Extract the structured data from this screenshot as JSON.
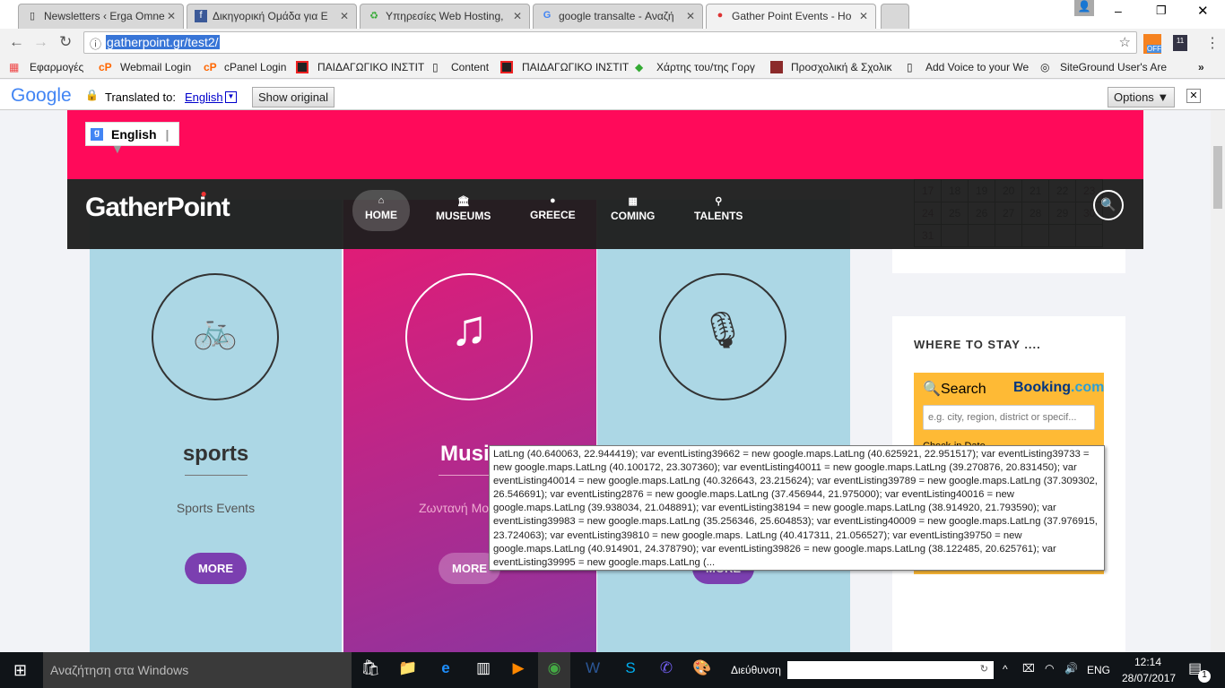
{
  "browser": {
    "tabs": [
      {
        "title": "Newsletters ‹ Erga Omne",
        "icon": "page-icon"
      },
      {
        "title": "Δικηγορική Ομάδα για Ε",
        "icon": "facebook-icon"
      },
      {
        "title": "Υπηρεσίες Web Hosting,",
        "icon": "recycle-icon"
      },
      {
        "title": "google transalte - Αναζή",
        "icon": "google-icon"
      },
      {
        "title": "Gather Point Events - Ho",
        "icon": "map-pin-icon"
      }
    ],
    "url": "gatherpoint.gr/test2/",
    "ext_badge": "OFF",
    "ext2": "11",
    "bookmarks": [
      "Εφαρμογές",
      "Webmail Login",
      "cPanel Login",
      "ΠΑΙΔΑΓΩΓΙΚΟ ΙΝΣΤΙΤ",
      "Content",
      "ΠΑΙΔΑΓΩΓΙΚΟ ΙΝΣΤΙΤ",
      "Χάρτης του/της Γοργ",
      "Προσχολική & Σχολικ",
      "Add Voice to your We",
      "SiteGround User's Are"
    ],
    "more_bookmarks": "»"
  },
  "translate": {
    "logo": "Google",
    "label": "Translated to:",
    "language": "English",
    "show_original": "Show original",
    "options": "Options ▼",
    "close": "✕"
  },
  "site": {
    "language_selector": "English",
    "logo": "GatherPoint",
    "nav": [
      {
        "label": "HOME",
        "icon": "⌂"
      },
      {
        "label": "MUSEUMS",
        "icon": "🏛"
      },
      {
        "label": "GREECE",
        "icon": "●"
      },
      {
        "label": "COMING",
        "icon": "▦"
      },
      {
        "label": "TALENTS",
        "icon": "⚲"
      }
    ],
    "cards": [
      {
        "title": "sports",
        "subtitle": "Sports Events",
        "button": "MORE",
        "icon": "🚲"
      },
      {
        "title": "Musi",
        "subtitle": "Ζωντανή Μο",
        "button": "MORE",
        "icon": "♫"
      },
      {
        "title": "",
        "subtitle": "",
        "button": "MORE",
        "icon": "🎙"
      }
    ],
    "calendar": [
      [
        "17",
        "18",
        "19",
        "20",
        "21",
        "22",
        "23"
      ],
      [
        "24",
        "25",
        "26",
        "27",
        "28",
        "29",
        "30"
      ],
      [
        "31",
        "",
        "",
        "",
        "",
        "",
        ""
      ]
    ],
    "where_to_stay": "WHERE TO STAY ....",
    "booking": {
      "search": "Search",
      "brand": "Booking",
      "brand_suffix": ".com",
      "placeholder": "e.g. city, region, district or specif...",
      "checkin": "Check-in Date"
    }
  },
  "tooltip": "LatLng (40.640063, 22.944419);  var eventListing39662 = new google.maps.LatLng (40.625921, 22.951517);  var eventListing39733 = new google.maps.LatLng (40.100172, 23.307360);  var eventListing40011 = new google.maps.LatLng (39.270876, 20.831450);  var eventListing40014 = new google.maps.LatLng (40.326643, 23.215624);  var eventListing39789 = new google.maps.LatLng (37.309302, 26.546691);  var eventListing2876 = new google.maps.LatLng (37.456944, 21.975000);  var eventListing40016 = new google.maps.LatLng (39.938034, 21.048891);  var eventListing38194 = new google.maps.LatLng (38.914920, 21.793590);  var eventListing39983 = new google.maps.LatLng (35.256346, 25.604853);  var eventListing40009 = new google.maps.LatLng (37.976915, 23.724063);  var eventListing39810 = new google.maps.  LatLng (40.417311, 21.056527);  var eventListing39750 = new google.maps.LatLng (40.914901, 24.378790);  var eventListing39826 = new google.maps.LatLng (38.122485, 20.625761);  var eventListing39995 = new google.maps.LatLng (...",
  "taskbar": {
    "search_placeholder": "Αναζήτηση στα Windows",
    "address_label": "Διεύθυνση",
    "lang": "ENG",
    "time": "12:14",
    "date": "28/07/2017",
    "notifications": "1"
  },
  "colors": {
    "pink": "#ff0a5a",
    "nav": "#1e1e1e",
    "card_blue": "#acd7e5",
    "button_purple": "#7b3fb0",
    "booking": "#feba35"
  }
}
